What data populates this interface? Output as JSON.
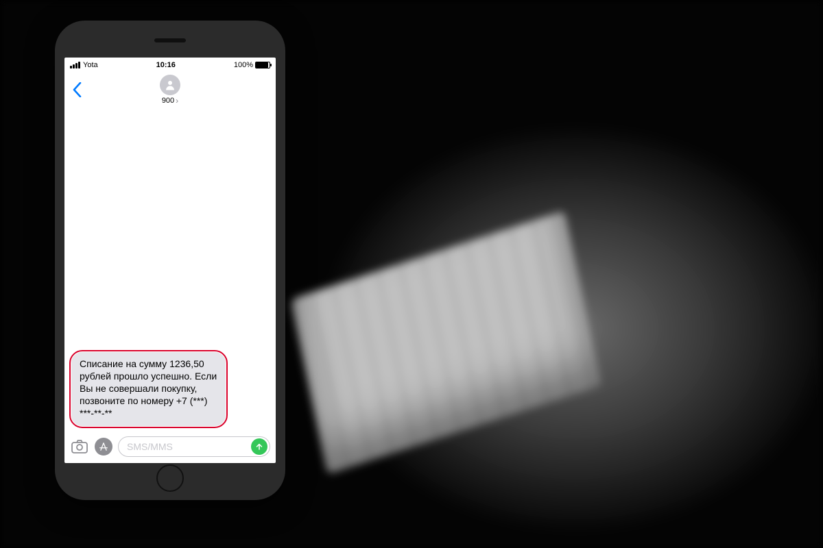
{
  "statusbar": {
    "carrier": "Yota",
    "time": "10:16",
    "battery": "100%"
  },
  "header": {
    "contact_name": "900"
  },
  "message": {
    "text": "Списание на сумму 1236,50 рублей прошло успешно. Если Вы не совершали покупку, позвоните по номеру +7 (***) ***-**-**"
  },
  "composer": {
    "placeholder": "SMS/MMS"
  }
}
